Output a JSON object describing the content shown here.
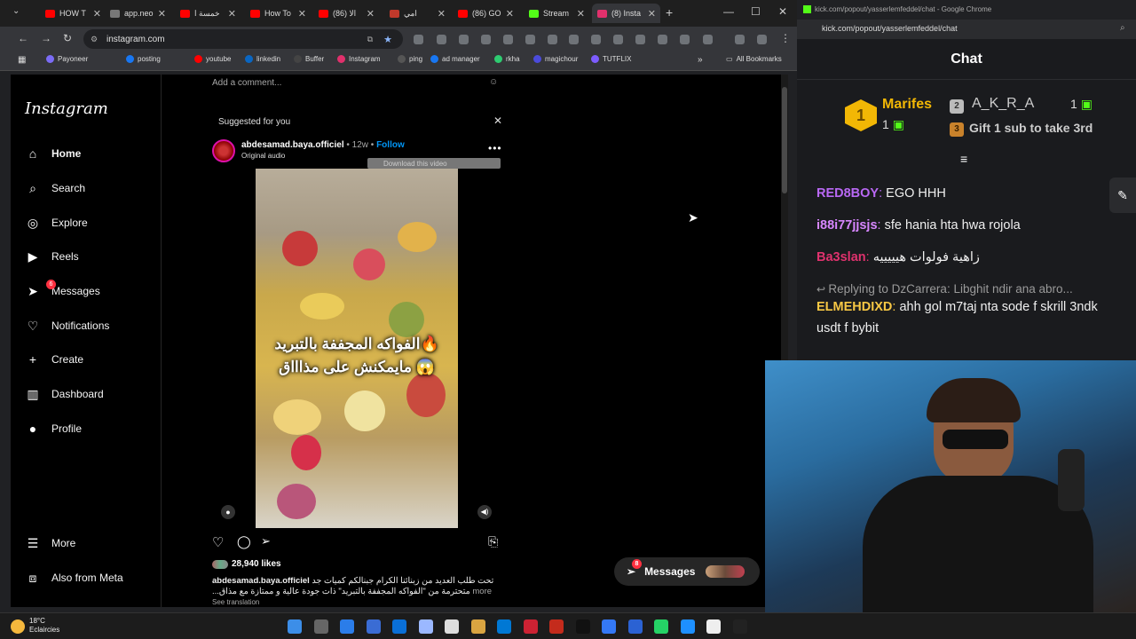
{
  "browser": {
    "tabs": [
      {
        "label": "HOW T",
        "color": "#ff0000"
      },
      {
        "label": "app.neo",
        "color": "#777777"
      },
      {
        "label": "خمسة ا",
        "color": "#ff0000"
      },
      {
        "label": "How To",
        "color": "#ff0000"
      },
      {
        "label": "(86) الا",
        "color": "#ff0000"
      },
      {
        "label": "امي",
        "color": "#c0392b"
      },
      {
        "label": "(86) GO",
        "color": "#ff0000"
      },
      {
        "label": "Stream",
        "color": "#53fc18"
      },
      {
        "label": "(8) Insta",
        "color": "#e1306c"
      }
    ],
    "new_tab": "+",
    "url": "instagram.com",
    "bookmarks": [
      "Payoneer",
      "posting",
      "youtube",
      "linkedin",
      "Buffer",
      "Instagram",
      "ping",
      "ad manager",
      "rkha",
      "magichour",
      "TUTFLIX"
    ],
    "all_bookmarks": "All Bookmarks"
  },
  "instagram": {
    "logo": "Instagram",
    "nav": [
      {
        "label": "Home",
        "icon": "⌂",
        "name": "home"
      },
      {
        "label": "Search",
        "icon": "⌕",
        "name": "search"
      },
      {
        "label": "Explore",
        "icon": "◎",
        "name": "explore"
      },
      {
        "label": "Reels",
        "icon": "▶",
        "name": "reels"
      },
      {
        "label": "Messages",
        "icon": "➤",
        "name": "messages"
      },
      {
        "label": "Notifications",
        "icon": "♡",
        "name": "notifications"
      },
      {
        "label": "Create",
        "icon": "+",
        "name": "create"
      },
      {
        "label": "Dashboard",
        "icon": "▥",
        "name": "dashboard"
      },
      {
        "label": "Profile",
        "icon": "●",
        "name": "profile"
      }
    ],
    "messages_badge": "6",
    "more": "More",
    "also_meta": "Also from Meta",
    "add_comment": "Add a comment...",
    "suggested": "Suggested for you",
    "post": {
      "username": "abdesamad.baya.officiel",
      "age": "• 12w •",
      "follow": "Follow",
      "audio": "Original audio",
      "download": "Download this video",
      "caption_overlay_1": "الفواكه المجففة بالتبريد🔥",
      "caption_overlay_2": "مايمكنش على مذاااق 😱",
      "likes": "28,940 likes",
      "caption_user": "abdesamad.baya.officiel",
      "caption_1": "تحت طلب العديد من زبنائنا الكرام جبنالكم كميات جد",
      "caption_2": "متحترمة من \"الفواكه المجففة بالتبريد\" ذات جودة عالية و ممتازة مع مذاق...",
      "more": "more",
      "see_translation": "See translation"
    },
    "messages_pill": "Messages",
    "messages_pill_badge": "8"
  },
  "kick": {
    "window_title": "kick.com/popout/yasserlemfeddel/chat - Google Chrome",
    "url": "kick.com/popout/yasserlemfeddel/chat",
    "chat_title": "Chat",
    "leaders": [
      {
        "rank": "1",
        "name": "Marifes",
        "count": "1"
      },
      {
        "rank": "2",
        "name": "A_K_R_A",
        "count": "1"
      },
      {
        "rank": "3",
        "name": "Gift 1 sub to take 3rd",
        "count": ""
      }
    ],
    "messages": [
      {
        "user": "RED8BOY",
        "color": "#b968f4",
        "text": " EGO HHH"
      },
      {
        "user": "i88i77jjsjs",
        "color": "#d786ff",
        "text": " sfe hania hta hwa rojola"
      },
      {
        "user": "Ba3slan",
        "color": "#e0326e",
        "text": " زاهية فولوات هيييييه"
      },
      {
        "reply": "Replying to DzCarrera: Libghit ndir ana abro..."
      },
      {
        "user": "ELMEHDIXD",
        "color": "#f7c744",
        "text": " ahh gol m7taj nta sode f skrill 3ndk usdt f bybit"
      }
    ]
  },
  "taskbar": {
    "weather_temp": "18°C",
    "weather_desc": "Eclaircies"
  },
  "colors": {
    "ig_bg": "#000000",
    "follow_blue": "#0095f6",
    "badge_red": "#ff3040",
    "kick_green": "#53fc18"
  }
}
